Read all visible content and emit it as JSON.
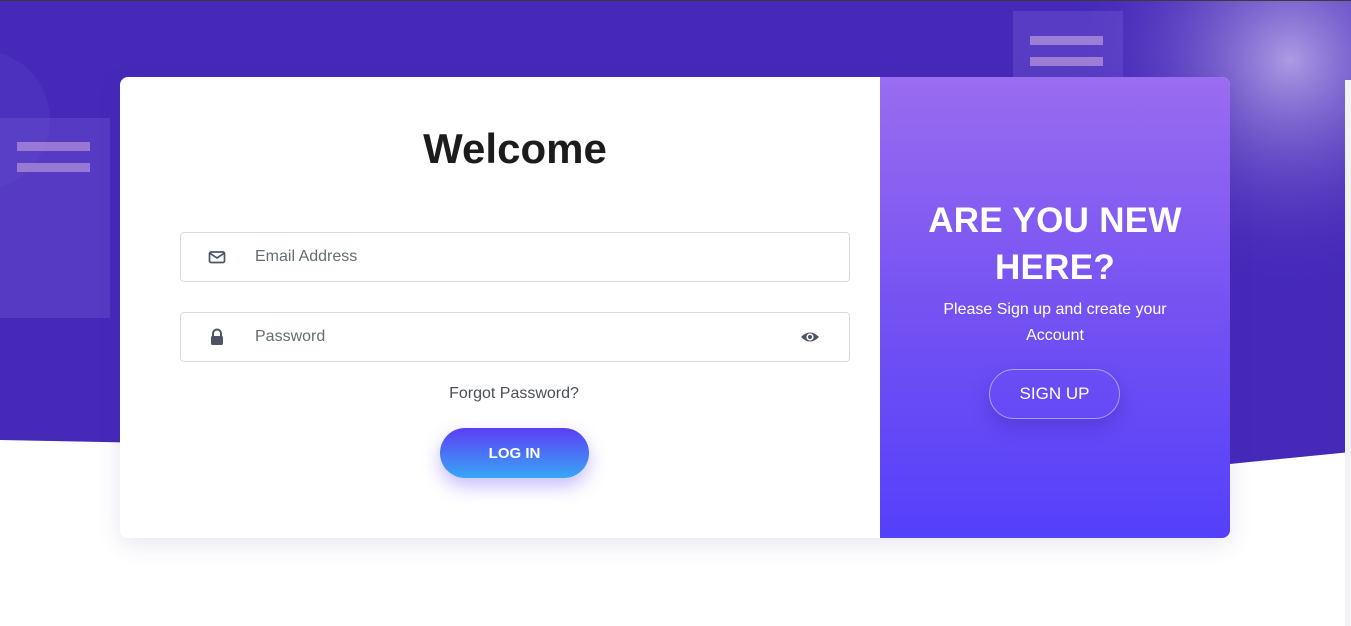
{
  "colors": {
    "hero_bg": "#4629b9",
    "card_bg": "#ffffff",
    "signup_gradient_top": "#9a6cf0",
    "signup_gradient_bottom": "#5440fb",
    "login_btn_top": "#5b3ff4",
    "login_btn_bottom": "#38a6f7",
    "icon_color": "#4b5565"
  },
  "login": {
    "title": "Welcome",
    "email": {
      "placeholder": "Email Address",
      "value": "",
      "icon": "envelope-icon"
    },
    "password": {
      "placeholder": "Password",
      "value": "",
      "icon": "lock-icon",
      "toggle_icon": "eye-icon"
    },
    "forgot_label": "Forgot Password?",
    "submit_label": "LOG IN"
  },
  "signup": {
    "title": "ARE YOU NEW HERE?",
    "subtitle": "Please Sign up and create your Account",
    "button_label": "SIGN UP"
  }
}
